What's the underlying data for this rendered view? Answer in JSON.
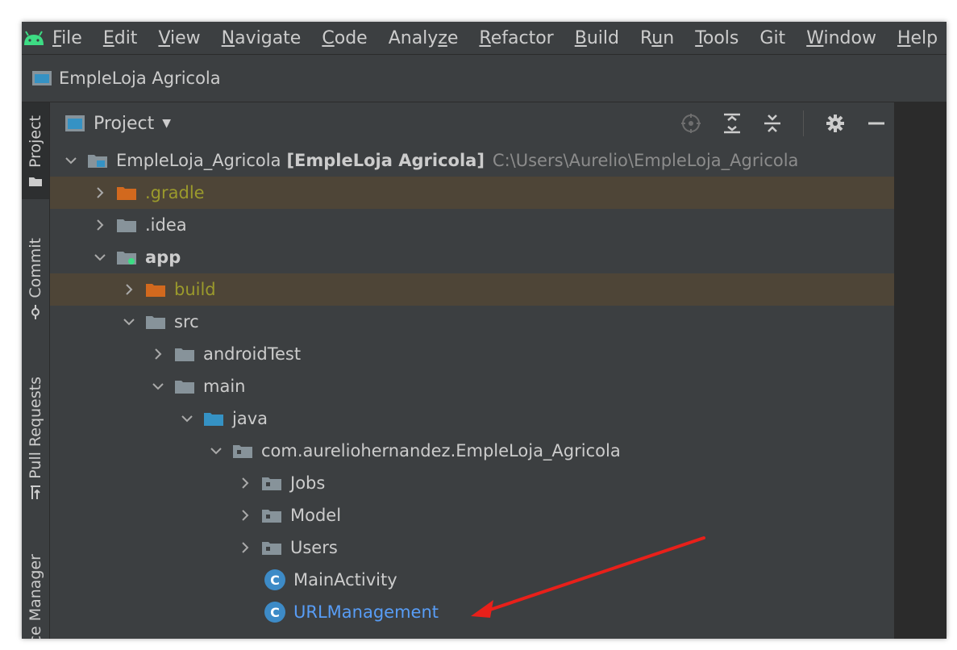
{
  "menubar": {
    "items": [
      "File",
      "Edit",
      "View",
      "Navigate",
      "Code",
      "Analyze",
      "Refactor",
      "Build",
      "Run",
      "Tools",
      "Git",
      "Window",
      "Help"
    ],
    "mnemonic_index": [
      0,
      0,
      0,
      0,
      0,
      5,
      0,
      0,
      1,
      0,
      -1,
      0,
      0
    ]
  },
  "navbar": {
    "module": "EmpleLoja Agricola"
  },
  "left_strip": {
    "tabs": [
      "Project",
      "Commit",
      "Pull Requests",
      "ce Manager"
    ]
  },
  "panel": {
    "title": "Project"
  },
  "tree": {
    "root": {
      "name": "EmpleLoja_Agricola",
      "bracket": "[EmpleLoja Agricola]",
      "path": "C:\\Users\\Aurelio\\EmpleLoja_Agricola"
    },
    "gradle": ".gradle",
    "idea": ".idea",
    "app": "app",
    "build": "build",
    "src": "src",
    "androidTest": "androidTest",
    "main": "main",
    "java": "java",
    "package": "com.aureliohernandez.EmpleLoja_Agricola",
    "jobs": "Jobs",
    "model": "Model",
    "users": "Users",
    "main_activity": "MainActivity",
    "url_management": "URLManagement",
    "class_badge": "C"
  },
  "colors": {
    "ide_bg": "#3c3f41",
    "excluded_bg": "#4e4537",
    "excluded_text": "#9b9a2c",
    "excluded_folder": "#d2691e",
    "java_folder": "#3592c4",
    "class_badge": "#3d8bc7",
    "arrow": "#e8201a"
  }
}
